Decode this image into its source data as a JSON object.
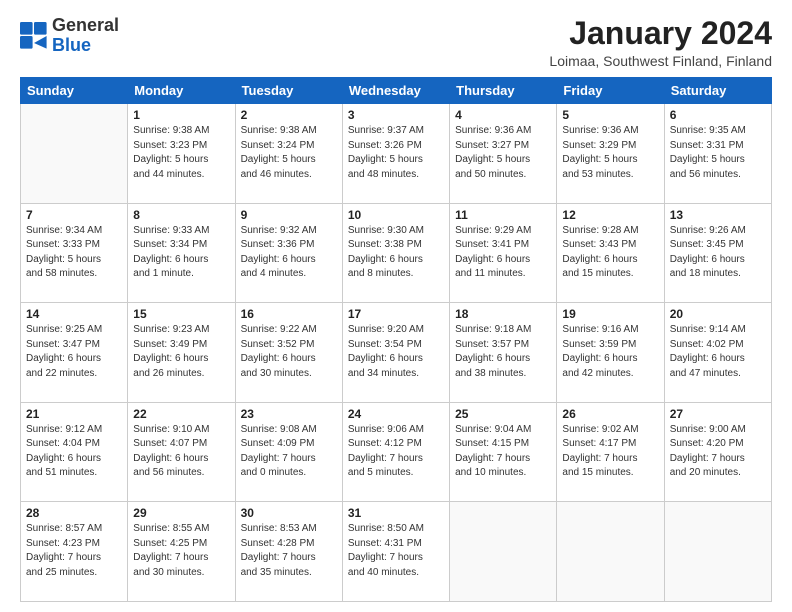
{
  "logo": {
    "general": "General",
    "blue": "Blue"
  },
  "header": {
    "month_title": "January 2024",
    "location": "Loimaa, Southwest Finland, Finland"
  },
  "weekdays": [
    "Sunday",
    "Monday",
    "Tuesday",
    "Wednesday",
    "Thursday",
    "Friday",
    "Saturday"
  ],
  "weeks": [
    [
      {
        "day": "",
        "info": ""
      },
      {
        "day": "1",
        "info": "Sunrise: 9:38 AM\nSunset: 3:23 PM\nDaylight: 5 hours\nand 44 minutes."
      },
      {
        "day": "2",
        "info": "Sunrise: 9:38 AM\nSunset: 3:24 PM\nDaylight: 5 hours\nand 46 minutes."
      },
      {
        "day": "3",
        "info": "Sunrise: 9:37 AM\nSunset: 3:26 PM\nDaylight: 5 hours\nand 48 minutes."
      },
      {
        "day": "4",
        "info": "Sunrise: 9:36 AM\nSunset: 3:27 PM\nDaylight: 5 hours\nand 50 minutes."
      },
      {
        "day": "5",
        "info": "Sunrise: 9:36 AM\nSunset: 3:29 PM\nDaylight: 5 hours\nand 53 minutes."
      },
      {
        "day": "6",
        "info": "Sunrise: 9:35 AM\nSunset: 3:31 PM\nDaylight: 5 hours\nand 56 minutes."
      }
    ],
    [
      {
        "day": "7",
        "info": "Sunrise: 9:34 AM\nSunset: 3:33 PM\nDaylight: 5 hours\nand 58 minutes."
      },
      {
        "day": "8",
        "info": "Sunrise: 9:33 AM\nSunset: 3:34 PM\nDaylight: 6 hours\nand 1 minute."
      },
      {
        "day": "9",
        "info": "Sunrise: 9:32 AM\nSunset: 3:36 PM\nDaylight: 6 hours\nand 4 minutes."
      },
      {
        "day": "10",
        "info": "Sunrise: 9:30 AM\nSunset: 3:38 PM\nDaylight: 6 hours\nand 8 minutes."
      },
      {
        "day": "11",
        "info": "Sunrise: 9:29 AM\nSunset: 3:41 PM\nDaylight: 6 hours\nand 11 minutes."
      },
      {
        "day": "12",
        "info": "Sunrise: 9:28 AM\nSunset: 3:43 PM\nDaylight: 6 hours\nand 15 minutes."
      },
      {
        "day": "13",
        "info": "Sunrise: 9:26 AM\nSunset: 3:45 PM\nDaylight: 6 hours\nand 18 minutes."
      }
    ],
    [
      {
        "day": "14",
        "info": "Sunrise: 9:25 AM\nSunset: 3:47 PM\nDaylight: 6 hours\nand 22 minutes."
      },
      {
        "day": "15",
        "info": "Sunrise: 9:23 AM\nSunset: 3:49 PM\nDaylight: 6 hours\nand 26 minutes."
      },
      {
        "day": "16",
        "info": "Sunrise: 9:22 AM\nSunset: 3:52 PM\nDaylight: 6 hours\nand 30 minutes."
      },
      {
        "day": "17",
        "info": "Sunrise: 9:20 AM\nSunset: 3:54 PM\nDaylight: 6 hours\nand 34 minutes."
      },
      {
        "day": "18",
        "info": "Sunrise: 9:18 AM\nSunset: 3:57 PM\nDaylight: 6 hours\nand 38 minutes."
      },
      {
        "day": "19",
        "info": "Sunrise: 9:16 AM\nSunset: 3:59 PM\nDaylight: 6 hours\nand 42 minutes."
      },
      {
        "day": "20",
        "info": "Sunrise: 9:14 AM\nSunset: 4:02 PM\nDaylight: 6 hours\nand 47 minutes."
      }
    ],
    [
      {
        "day": "21",
        "info": "Sunrise: 9:12 AM\nSunset: 4:04 PM\nDaylight: 6 hours\nand 51 minutes."
      },
      {
        "day": "22",
        "info": "Sunrise: 9:10 AM\nSunset: 4:07 PM\nDaylight: 6 hours\nand 56 minutes."
      },
      {
        "day": "23",
        "info": "Sunrise: 9:08 AM\nSunset: 4:09 PM\nDaylight: 7 hours\nand 0 minutes."
      },
      {
        "day": "24",
        "info": "Sunrise: 9:06 AM\nSunset: 4:12 PM\nDaylight: 7 hours\nand 5 minutes."
      },
      {
        "day": "25",
        "info": "Sunrise: 9:04 AM\nSunset: 4:15 PM\nDaylight: 7 hours\nand 10 minutes."
      },
      {
        "day": "26",
        "info": "Sunrise: 9:02 AM\nSunset: 4:17 PM\nDaylight: 7 hours\nand 15 minutes."
      },
      {
        "day": "27",
        "info": "Sunrise: 9:00 AM\nSunset: 4:20 PM\nDaylight: 7 hours\nand 20 minutes."
      }
    ],
    [
      {
        "day": "28",
        "info": "Sunrise: 8:57 AM\nSunset: 4:23 PM\nDaylight: 7 hours\nand 25 minutes."
      },
      {
        "day": "29",
        "info": "Sunrise: 8:55 AM\nSunset: 4:25 PM\nDaylight: 7 hours\nand 30 minutes."
      },
      {
        "day": "30",
        "info": "Sunrise: 8:53 AM\nSunset: 4:28 PM\nDaylight: 7 hours\nand 35 minutes."
      },
      {
        "day": "31",
        "info": "Sunrise: 8:50 AM\nSunset: 4:31 PM\nDaylight: 7 hours\nand 40 minutes."
      },
      {
        "day": "",
        "info": ""
      },
      {
        "day": "",
        "info": ""
      },
      {
        "day": "",
        "info": ""
      }
    ]
  ]
}
